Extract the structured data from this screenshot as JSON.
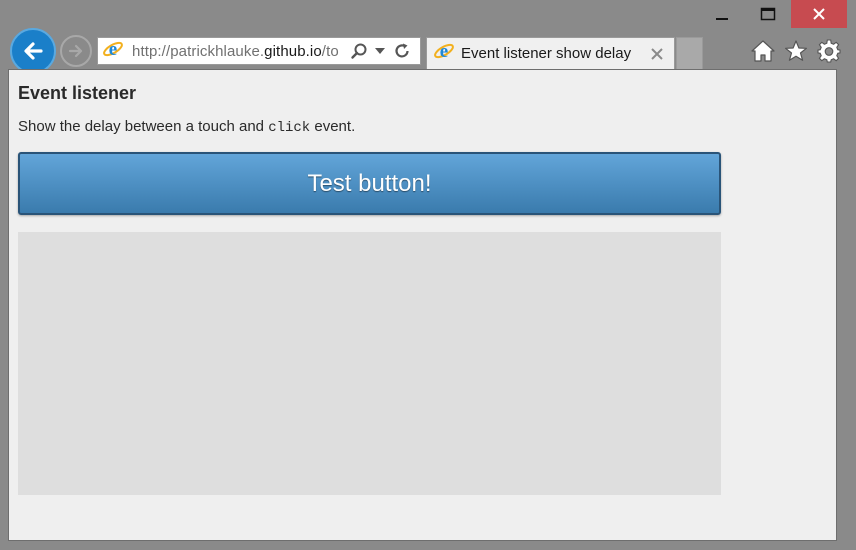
{
  "window": {
    "controls": [
      "minimize",
      "maximize",
      "close"
    ]
  },
  "nav": {
    "back_icon": "arrow-left-icon",
    "forward_icon": "arrow-right-icon"
  },
  "address_bar": {
    "url_prefix": "http://patrickhlauke.",
    "url_host": "github.io",
    "url_suffix": "/to"
  },
  "tab": {
    "title": "Event listener show delay",
    "close_icon": "close-icon"
  },
  "toolbar": {
    "icons": [
      "home-icon",
      "star-icon",
      "gear-icon"
    ]
  },
  "page": {
    "title": "Event listener",
    "description_before": "Show the delay between a touch and ",
    "description_code": "click",
    "description_after": " event.",
    "button_label": "Test button!"
  },
  "colors": {
    "button_top": "#62a5d9",
    "button_bottom": "#3a7bad",
    "close_button": "#c74b50",
    "output_area": "#dedede"
  }
}
